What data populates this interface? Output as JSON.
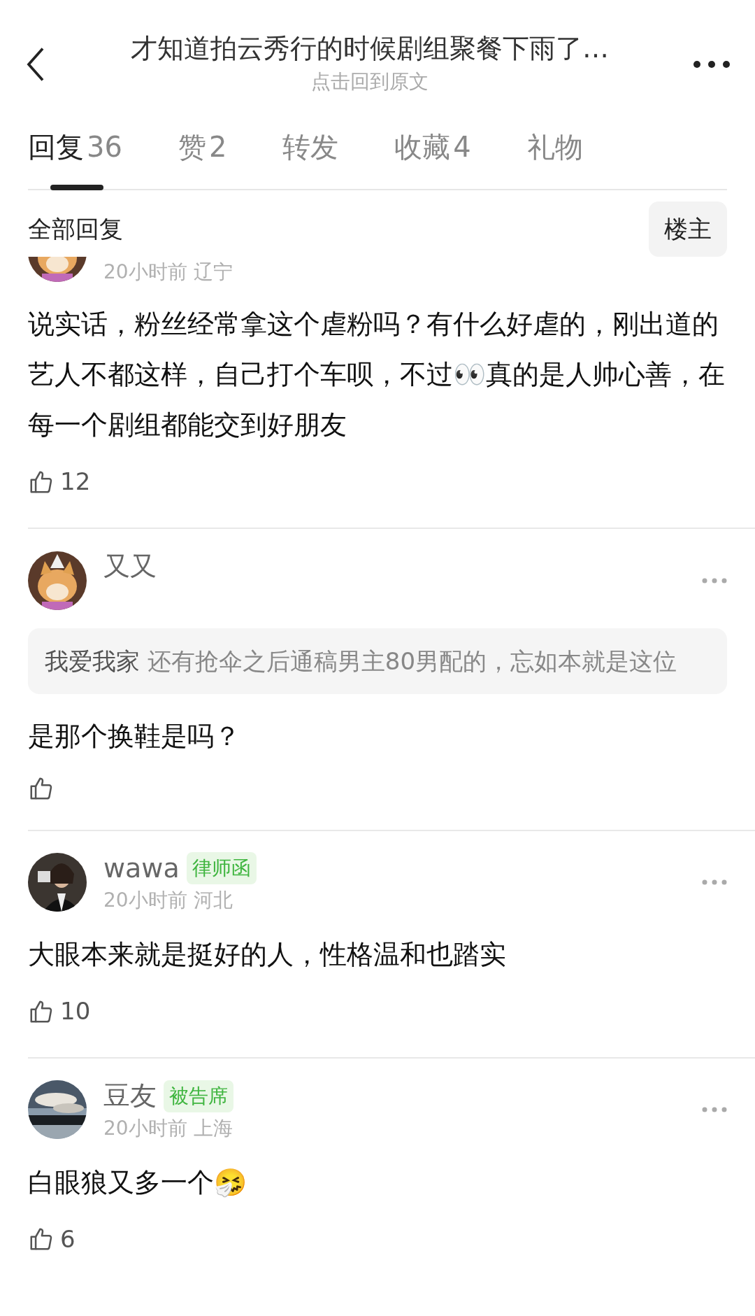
{
  "header": {
    "title": "才知道拍云秀行的时候剧组聚餐下雨了…",
    "subtitle": "点击回到原文"
  },
  "tabs": [
    {
      "label": "回复",
      "count": "36",
      "selected": true
    },
    {
      "label": "赞",
      "count": "2",
      "selected": false
    },
    {
      "label": "转发",
      "selected": false
    },
    {
      "label": "收藏",
      "count": "4",
      "selected": false
    },
    {
      "label": "礼物",
      "selected": false
    }
  ],
  "filter": {
    "label": "全部回复",
    "button": "楼主"
  },
  "comments": [
    {
      "time": "20小时前",
      "location": "辽宁",
      "text": "说实话，粉丝经常拿这个虐粉吗？有什么好虐的，刚出道的艺人不都这样，自己打个车呗，不过👀真的是人帅心善，在每一个剧组都能交到好朋友",
      "likes": "12"
    },
    {
      "name": "又又",
      "quote": {
        "author": "我爱我家",
        "text": "还有抢伞之后通稿男主80男配的，忘如本就是这位"
      },
      "text": "是那个换鞋是吗？"
    },
    {
      "name": "wawa",
      "badge": "律师函",
      "time": "20小时前",
      "location": "河北",
      "text": "大眼本来就是挺好的人，性格温和也踏实",
      "likes": "10"
    },
    {
      "name": "豆友",
      "badge": "被告席",
      "time": "20小时前",
      "location": "上海",
      "text": "白眼狼又多一个🤧",
      "likes": "6"
    }
  ]
}
